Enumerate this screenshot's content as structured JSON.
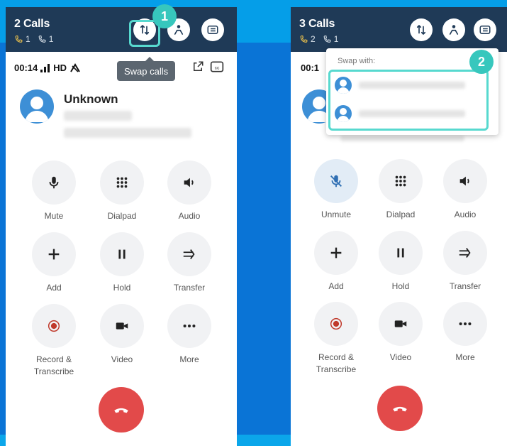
{
  "left": {
    "header": {
      "title": "2 Calls",
      "active_count": "1",
      "hold_count": "1"
    },
    "status": {
      "timer": "00:14",
      "quality": "HD"
    },
    "tooltip": "Swap calls",
    "caller": {
      "name": "Unknown"
    },
    "controls": [
      {
        "label": "Mute",
        "icon": "microphone-icon"
      },
      {
        "label": "Dialpad",
        "icon": "dialpad-icon"
      },
      {
        "label": "Audio",
        "icon": "speaker-icon"
      },
      {
        "label": "Add",
        "icon": "plus-icon"
      },
      {
        "label": "Hold",
        "icon": "pause-icon"
      },
      {
        "label": "Transfer",
        "icon": "transfer-icon"
      },
      {
        "label": "Record &\nTranscribe",
        "icon": "record-icon"
      },
      {
        "label": "Video",
        "icon": "video-icon"
      },
      {
        "label": "More",
        "icon": "more-icon"
      }
    ],
    "step_badge": "1"
  },
  "right": {
    "header": {
      "title": "3 Calls",
      "active_count": "2",
      "hold_count": "1"
    },
    "status": {
      "timer": "00:1"
    },
    "dropdown": {
      "title": "Swap with:"
    },
    "controls": [
      {
        "label": "Unmute",
        "icon": "microphone-muted-icon"
      },
      {
        "label": "Dialpad",
        "icon": "dialpad-icon"
      },
      {
        "label": "Audio",
        "icon": "speaker-icon"
      },
      {
        "label": "Add",
        "icon": "plus-icon"
      },
      {
        "label": "Hold",
        "icon": "pause-icon"
      },
      {
        "label": "Transfer",
        "icon": "transfer-icon"
      },
      {
        "label": "Record &\nTranscribe",
        "icon": "record-icon"
      },
      {
        "label": "Video",
        "icon": "video-icon"
      },
      {
        "label": "More",
        "icon": "more-icon"
      }
    ],
    "step_badge": "2"
  },
  "colors": {
    "header_bg": "#1f3a57",
    "end_call": "#e24a4a",
    "highlight": "#57d9cf",
    "badge": "#37c7bd",
    "background": "#0a74d6"
  }
}
